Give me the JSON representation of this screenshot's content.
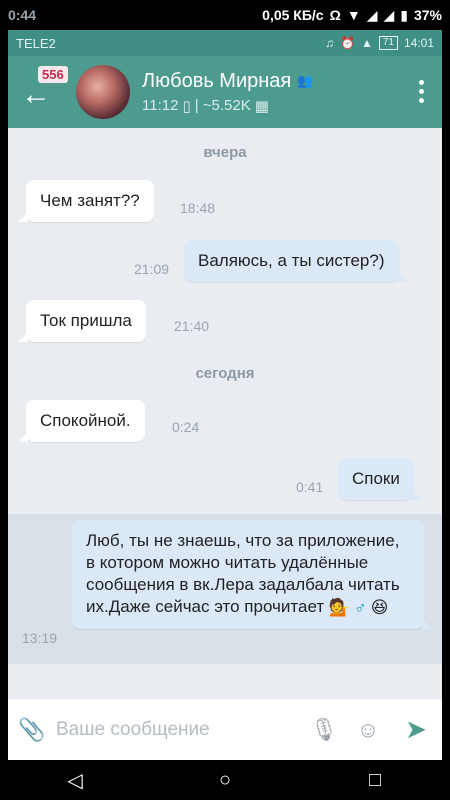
{
  "device": {
    "time": "0:44",
    "speed": "0,05 КБ/с",
    "battery": "37%",
    "inner_carrier": "TELE2",
    "inner_battery": "71",
    "inner_time": "14:01"
  },
  "header": {
    "badge": "556",
    "name": "Любовь Мирная",
    "last_seen": "11:12",
    "members": "| ~5.52K"
  },
  "messages": [
    {
      "type": "date",
      "text": "вчера"
    },
    {
      "type": "in",
      "text": "Чем занят??",
      "time": "18:48"
    },
    {
      "type": "out",
      "text": "Валяюсь, а ты систер?)",
      "time": "21:09"
    },
    {
      "type": "in",
      "text": "Ток пришла",
      "time": "21:40"
    },
    {
      "type": "date",
      "text": "сегодня"
    },
    {
      "type": "in",
      "text": "Спокойной.",
      "time": "0:24"
    },
    {
      "type": "out",
      "text": "Споки",
      "time": "0:41"
    },
    {
      "type": "out",
      "text": "Люб, ты не знаешь, что за приложение, в котором можно читать удалённые сообщения в вк.Лера задалбала читать их.Даже сейчас это прочитает",
      "time": "13:19",
      "emojis": [
        "💁",
        "♂",
        "😆"
      ]
    }
  ],
  "composer": {
    "placeholder": "Ваше сообщение"
  },
  "colors": {
    "header": "#4d9b8e",
    "chat_bg": "#e9edf1",
    "out_bubble": "#dbe8f8",
    "badge_text": "#c22b4f"
  }
}
